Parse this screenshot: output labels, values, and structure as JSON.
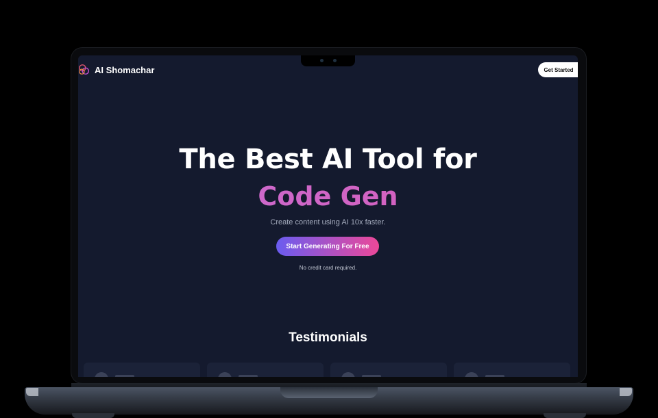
{
  "site": {
    "brand": "AI Shomachar",
    "nav": {
      "cta_label": "Get Started"
    }
  },
  "hero": {
    "title": "The Best AI Tool for",
    "accent": "Code Gen",
    "subtitle": "Create content using AI 10x faster.",
    "button_label": "Start Generating For Free",
    "note": "No credit card required."
  },
  "testimonials": {
    "title": "Testimonials",
    "cards": [
      {},
      {},
      {},
      {}
    ]
  },
  "colors": {
    "background": "#141a2e",
    "accent_start": "#6a5cf0",
    "accent_end": "#ec4899",
    "heading_gradient": "#cd62c4"
  }
}
